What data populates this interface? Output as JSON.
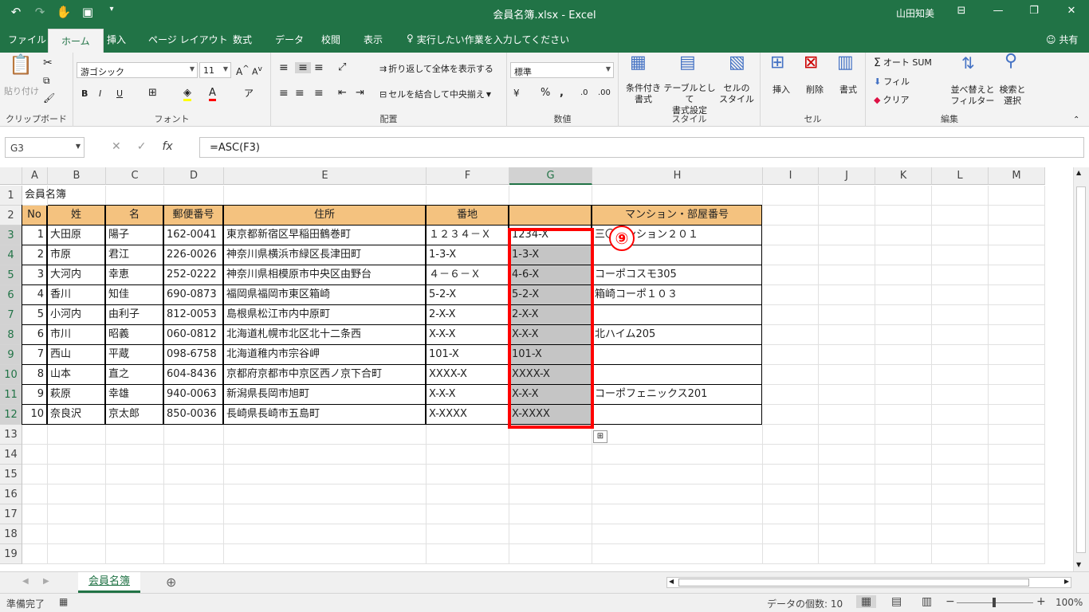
{
  "window": {
    "title": "会員名簿.xlsx  -  Excel",
    "user": "山田知美"
  },
  "tabs": [
    "ファイル",
    "ホーム",
    "挿入",
    "ページ レイアウト",
    "数式",
    "データ",
    "校閲",
    "表示"
  ],
  "tell_me": "実行したい作業を入力してください",
  "share": "共有",
  "ribbon": {
    "clipboard": {
      "paste": "貼り付け",
      "label": "クリップボード"
    },
    "font": {
      "name": "游ゴシック",
      "size": "11",
      "bold": "B",
      "italic": "I",
      "underline": "U",
      "label": "フォント"
    },
    "align": {
      "wrap": "折り返して全体を表示する",
      "merge": "セルを結合して中央揃え",
      "label": "配置"
    },
    "number": {
      "format": "標準",
      "percent": "%",
      "comma": ",",
      "label": "数値"
    },
    "styles": {
      "cond": "条件付き\n書式",
      "table": "テーブルとして\n書式設定",
      "cell": "セルの\nスタイル",
      "label": "スタイル"
    },
    "cells": {
      "insert": "挿入",
      "delete": "削除",
      "format": "書式",
      "label": "セル"
    },
    "editing": {
      "autosum": "オート SUM",
      "fill": "フィル",
      "clear": "クリア",
      "sort": "並べ替えと\nフィルター",
      "find": "検索と\n選択",
      "label": "編集"
    }
  },
  "formula_bar": {
    "namebox": "G3",
    "fx": "fx",
    "formula": "=ASC(F3)"
  },
  "columns": [
    "A",
    "B",
    "C",
    "D",
    "E",
    "F",
    "G",
    "H",
    "I",
    "J",
    "K",
    "L",
    "M"
  ],
  "rows": [
    "1",
    "2",
    "3",
    "4",
    "5",
    "6",
    "7",
    "8",
    "9",
    "10",
    "11",
    "12",
    "13",
    "14",
    "15",
    "16",
    "17",
    "18",
    "19"
  ],
  "sheet": {
    "title": "会員名簿",
    "headers": [
      "No",
      "姓",
      "名",
      "郵便番号",
      "住所",
      "番地",
      "",
      "マンション・部屋番号"
    ],
    "data": [
      [
        "1",
        "大田原",
        "陽子",
        "162-0041",
        "東京都新宿区早稲田鶴巻町",
        "１２３４－Ｘ",
        "1234-X",
        "三〇マンション２０１"
      ],
      [
        "2",
        "市原",
        "君江",
        "226-0026",
        "神奈川県横浜市緑区長津田町",
        "1-3-X",
        "1-3-X",
        ""
      ],
      [
        "3",
        "大河内",
        "幸恵",
        "252-0222",
        "神奈川県相模原市中央区由野台",
        "４－６－Ｘ",
        "4-6-X",
        "コーポコスモ305"
      ],
      [
        "4",
        "香川",
        "知佳",
        "690-0873",
        "福岡県福岡市東区箱崎",
        "5-2-X",
        "5-2-X",
        "箱崎コーポ１０３"
      ],
      [
        "5",
        "小河内",
        "由利子",
        "812-0053",
        "島根県松江市内中原町",
        "2-X-X",
        "2-X-X",
        ""
      ],
      [
        "6",
        "市川",
        "昭義",
        "060-0812",
        "北海道札幌市北区北十二条西",
        "X-X-X",
        "X-X-X",
        "北ハイム205"
      ],
      [
        "7",
        "西山",
        "平蔵",
        "098-6758",
        "北海道稚内市宗谷岬",
        "101-X",
        "101-X",
        ""
      ],
      [
        "8",
        "山本",
        "直之",
        "604-8436",
        "京都府京都市中京区西ノ京下合町",
        "XXXX-X",
        "XXXX-X",
        ""
      ],
      [
        "9",
        "萩原",
        "幸雄",
        "940-0063",
        "新潟県長岡市旭町",
        "X-X-X",
        "X-X-X",
        "コーポフェニックス201"
      ],
      [
        "10",
        "奈良沢",
        "京太郎",
        "850-0036",
        "長崎県長崎市五島町",
        "X-XXXX",
        "X-XXXX",
        ""
      ]
    ]
  },
  "annotation": "⑨",
  "sheet_tab": "会員名簿",
  "status": {
    "ready": "準備完了",
    "count": "データの個数: 10",
    "zoom": "100%"
  }
}
